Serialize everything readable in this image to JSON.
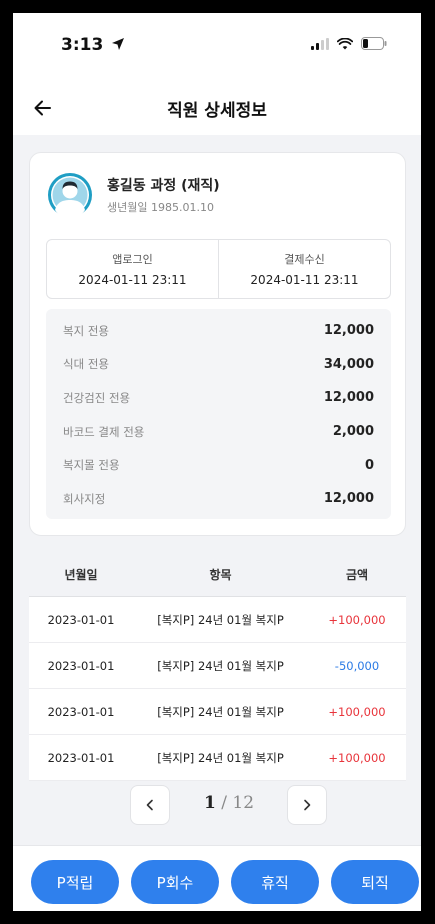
{
  "status_bar": {
    "time": "3:13"
  },
  "header": {
    "title": "직원 상세정보"
  },
  "profile": {
    "name": "홍길동 과정 (재직)",
    "birth": "생년월일 1985.01.10"
  },
  "log": [
    {
      "label": "앱로그인",
      "value": "2024-01-11 23:11"
    },
    {
      "label": "결제수신",
      "value": "2024-01-11 23:11"
    }
  ],
  "balances": [
    {
      "label": "복지 전용",
      "value": "12,000"
    },
    {
      "label": "식대 전용",
      "value": "34,000"
    },
    {
      "label": "건강검진 전용",
      "value": "12,000"
    },
    {
      "label": "바코드 결제 전용",
      "value": "2,000"
    },
    {
      "label": "복지몰 전용",
      "value": "0"
    },
    {
      "label": "회사지정",
      "value": "12,000"
    }
  ],
  "table": {
    "headers": [
      "년월일",
      "항목",
      "금액"
    ],
    "rows": [
      {
        "date": "2023-01-01",
        "item": "[복지P] 24년 01월 복지P",
        "amount": "+100,000"
      },
      {
        "date": "2023-01-01",
        "item": "[복지P] 24년 01월 복지P",
        "amount": "-50,000"
      },
      {
        "date": "2023-01-01",
        "item": "[복지P] 24년 01월 복지P",
        "amount": "+100,000"
      },
      {
        "date": "2023-01-01",
        "item": "[복지P] 24년 01월 복지P",
        "amount": "+100,000"
      }
    ]
  },
  "pagination": {
    "current": "1",
    "separator": "/",
    "total": "12"
  },
  "actions": [
    "P적립",
    "P회수",
    "휴직",
    "퇴직"
  ],
  "colors": {
    "accent": "#2f80ed",
    "positive": "#e8343b",
    "negative": "#2c7be5"
  }
}
